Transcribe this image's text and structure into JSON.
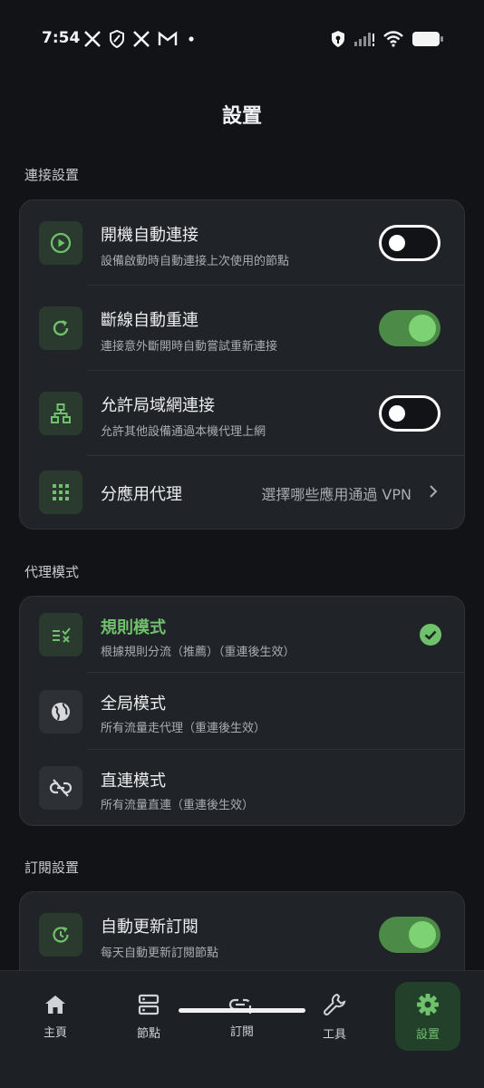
{
  "status_bar": {
    "time": "7:54",
    "left_icons": [
      "x-icon",
      "shield-icon",
      "x-icon",
      "gmail-icon",
      "dot-icon"
    ],
    "right_icons": [
      "vpn-key-icon",
      "signal-icon",
      "wifi-icon",
      "battery-icon"
    ]
  },
  "page": {
    "title": "設置"
  },
  "sections": {
    "connection": {
      "label": "連接設置",
      "items": [
        {
          "title": "開機自動連接",
          "subtitle": "設備啟動時自動連接上次使用的節點",
          "toggle": "off",
          "icon": "play-circle-icon"
        },
        {
          "title": "斷線自動重連",
          "subtitle": "連接意外斷開時自動嘗試重新連接",
          "toggle": "on",
          "icon": "refresh-icon"
        },
        {
          "title": "允許局域網連接",
          "subtitle": "允許其他設備通過本機代理上網",
          "toggle": "off",
          "icon": "network-tree-icon"
        },
        {
          "title": "分應用代理",
          "value": "選擇哪些應用通過 VPN",
          "icon": "grid-icon"
        }
      ]
    },
    "proxy_mode": {
      "label": "代理模式",
      "items": [
        {
          "title": "規則模式",
          "subtitle": "根據規則分流（推薦）（重連後生效）",
          "selected": true,
          "icon": "rule-icon"
        },
        {
          "title": "全局模式",
          "subtitle": "所有流量走代理（重連後生效）",
          "selected": false,
          "icon": "globe-icon"
        },
        {
          "title": "直連模式",
          "subtitle": "所有流量直連（重連後生效）",
          "selected": false,
          "icon": "link-off-icon"
        }
      ]
    },
    "subscription": {
      "label": "訂閱設置",
      "items": [
        {
          "title": "自動更新訂閱",
          "subtitle": "每天自動更新訂閱節點",
          "toggle": "on",
          "icon": "update-icon"
        }
      ]
    }
  },
  "bottom_nav": {
    "items": [
      {
        "label": "主頁",
        "icon": "home-icon",
        "active": false
      },
      {
        "label": "節點",
        "icon": "server-icon",
        "active": false
      },
      {
        "label": "訂閱",
        "icon": "link-add-icon",
        "active": false
      },
      {
        "label": "工具",
        "icon": "wrench-icon",
        "active": false
      },
      {
        "label": "設置",
        "icon": "gear-icon",
        "active": true
      }
    ]
  },
  "colors": {
    "background": "#111316",
    "card": "#202327",
    "accent": "#6fc16b",
    "toggle_on": "#4c8a47",
    "icon_box": "#2b3a2e"
  }
}
